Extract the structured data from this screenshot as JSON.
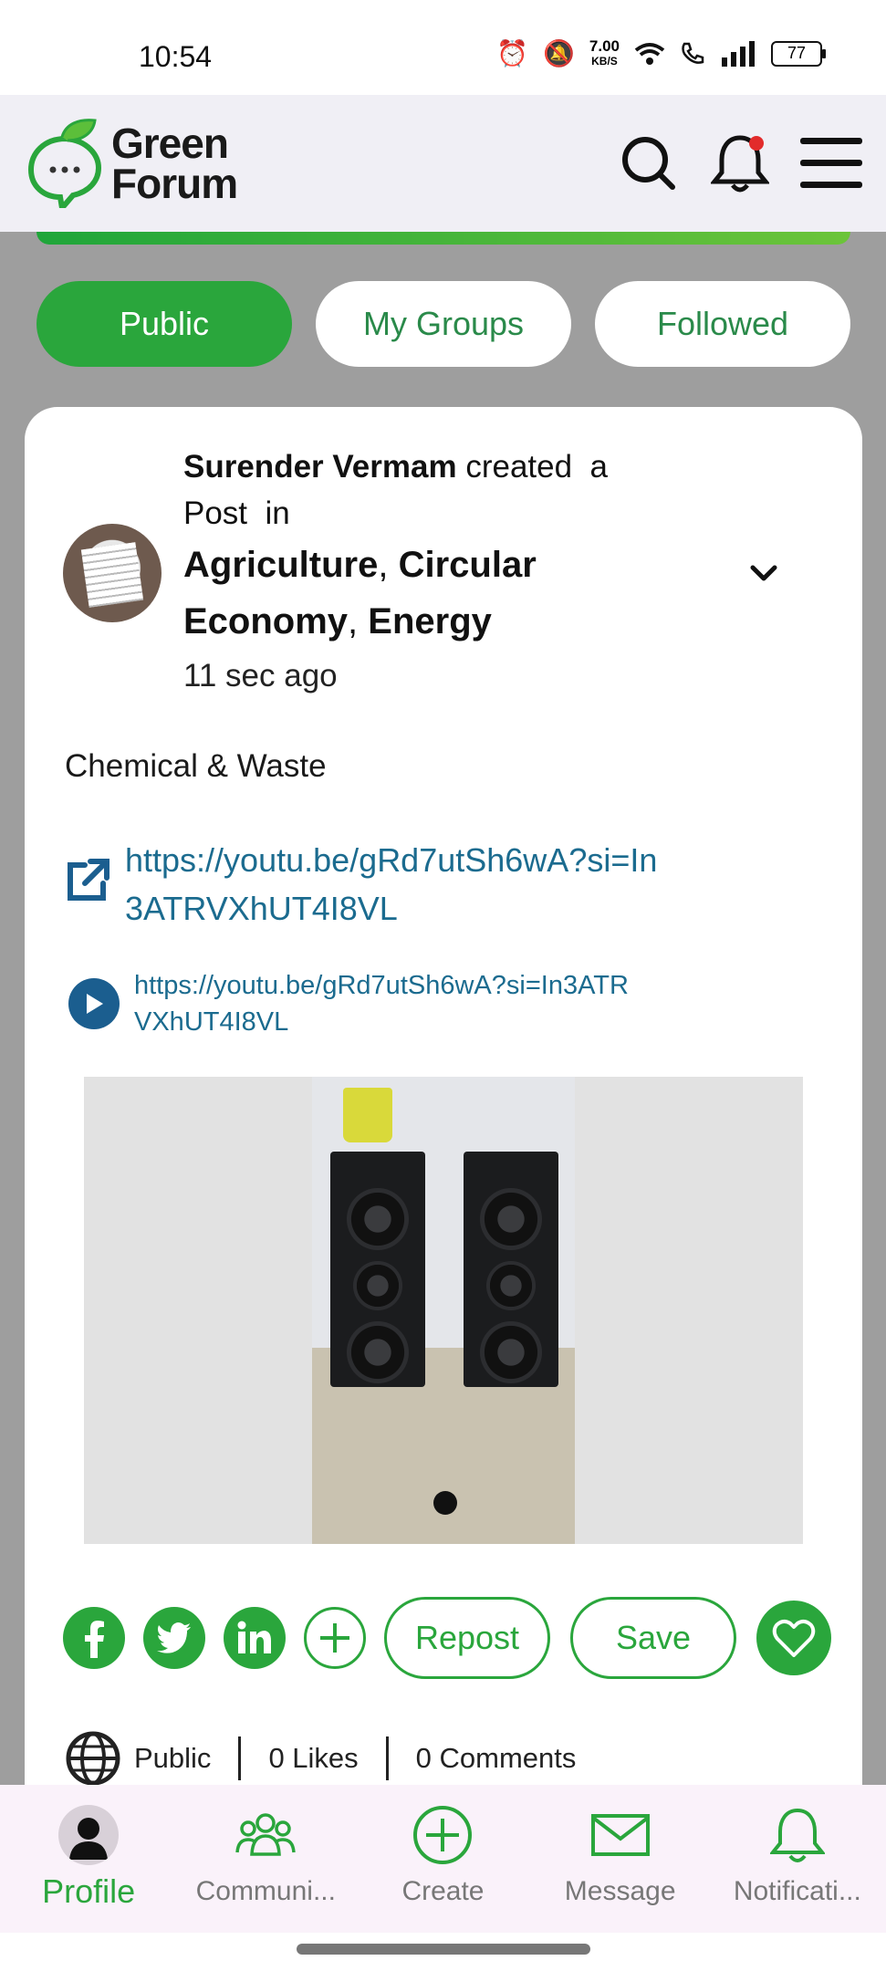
{
  "status_bar": {
    "time": "10:54",
    "net_speed": "7.00",
    "net_unit": "KB/S",
    "battery": "77"
  },
  "header": {
    "logo_line1": "Green",
    "logo_line2": "Forum"
  },
  "tabs": [
    {
      "label": "Public",
      "active": true
    },
    {
      "label": "My Groups",
      "active": false
    },
    {
      "label": "Followed",
      "active": false
    }
  ],
  "post": {
    "author": "Surender Vermam",
    "action": "created  a",
    "action2": "Post  in",
    "groups": [
      "Agriculture",
      "Circular",
      "Economy",
      "Energy"
    ],
    "time_ago": "11 sec ago",
    "text": "Chemical & Waste",
    "link_url": "https://youtu.be/gRd7utSh6wA?si=In3ATRVXhUT4I8VL",
    "video_url": "https://youtu.be/gRd7utSh6wA?si=In3ATRVXhUT4I8VL"
  },
  "actions": {
    "repost_label": "Repost",
    "save_label": "Save"
  },
  "stats": {
    "visibility": "Public",
    "likes": "0 Likes",
    "comments": "0 Comments"
  },
  "bottom_nav": [
    {
      "label": "Profile",
      "icon": "profile-icon",
      "active": true
    },
    {
      "label": "Communi...",
      "icon": "community-icon",
      "active": false
    },
    {
      "label": "Create",
      "icon": "plus-circle-icon",
      "active": false
    },
    {
      "label": "Message",
      "icon": "envelope-icon",
      "active": false
    },
    {
      "label": "Notificati...",
      "icon": "bell-icon",
      "active": false
    }
  ],
  "colors": {
    "brand_green": "#2aa63c",
    "link_blue": "#1b6b8f",
    "page_bg": "#9e9e9e"
  }
}
